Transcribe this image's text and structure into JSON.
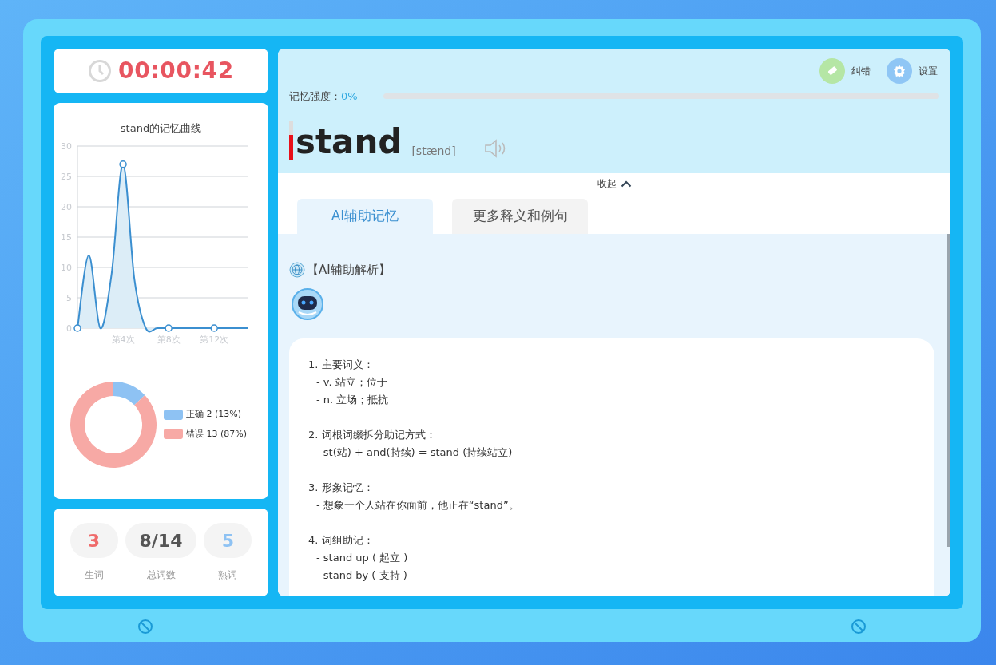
{
  "timer": {
    "time": "00:00:42"
  },
  "memory_chart": {
    "title": "stand的记忆曲线",
    "chart_data": {
      "type": "area",
      "categories": [
        null,
        null,
        null,
        null,
        "第4次",
        null,
        null,
        null,
        "第8次",
        null,
        null,
        null,
        "第12次",
        null,
        null,
        null
      ],
      "ylim": [
        0,
        30
      ],
      "grid": true,
      "yticks": [
        0,
        5,
        10,
        15,
        20,
        25,
        30
      ],
      "series": [
        {
          "color": "#3b8fd0",
          "values": [
            0,
            12,
            0,
            9,
            27,
            8,
            0,
            0,
            0,
            0,
            0,
            0,
            0,
            0,
            0,
            0
          ]
        }
      ]
    }
  },
  "result_chart": {
    "chart_data": {
      "type": "donut",
      "series": [
        {
          "values": [
            13,
            87
          ]
        }
      ]
    },
    "legend": [
      {
        "label": "正确 2 (13%)",
        "color": "#8ec2f3"
      },
      {
        "label": "错误 13 (87%)",
        "color": "#f7a9a5"
      }
    ]
  },
  "stats": [
    {
      "value": "3",
      "label": "生词",
      "color": "#ef6b6b"
    },
    {
      "value": "8/14",
      "label": "总词数",
      "color": "#555555"
    },
    {
      "value": "5",
      "label": "熟词",
      "color": "#8ec2f3"
    }
  ],
  "toolbar": [
    {
      "label": "纠错",
      "kind": "eraser"
    },
    {
      "label": "设置",
      "kind": "settings"
    }
  ],
  "memory_strength": {
    "label": "记忆强度：",
    "value": "0%",
    "level": 0
  },
  "word": {
    "text": "stand",
    "phonetic": "[stænd]"
  },
  "collapse": {
    "label": "收起"
  },
  "tabs": [
    {
      "label": "AI辅助记忆",
      "selected": true
    },
    {
      "label": "更多释义和例句",
      "selected": false
    }
  ],
  "analysis": {
    "heading": "【AI辅助解析】",
    "sections": [
      {
        "title": "1. 主要词义：",
        "lines": [
          "- v. 站立；位于",
          "- n. 立场；抵抗"
        ]
      },
      {
        "title": "2. 词根词缀拆分助记方式：",
        "lines": [
          "- st(站) + and(持续) = stand (持续站立)"
        ]
      },
      {
        "title": "3. 形象记忆：",
        "lines": [
          "- 想象一个人站在你面前，他正在“stand”。"
        ]
      },
      {
        "title": "4. 词组助记：",
        "lines": [
          "- stand up ( 起立 )",
          "- stand by ( 支持 )"
        ]
      }
    ]
  }
}
